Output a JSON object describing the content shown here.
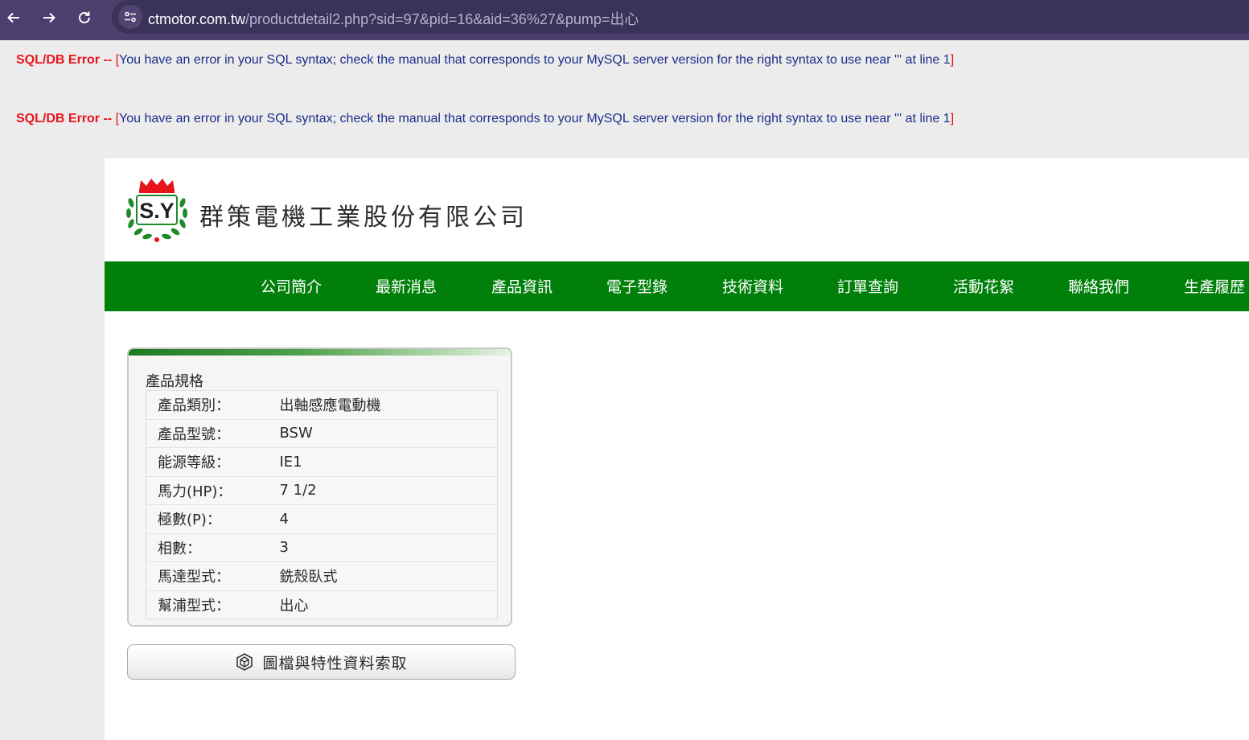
{
  "browser": {
    "url_host": "ctmotor.com.tw",
    "url_path": "/productdetail2.php?sid=97&pid=16&aid=36%27&pump=出心"
  },
  "errors": [
    {
      "label": "SQL/DB Error -- ",
      "bracket_open": "[",
      "message": "You have an error in your SQL syntax; check the manual that corresponds to your MySQL server version for the right syntax to use near ''' at line 1",
      "bracket_close": "]"
    },
    {
      "label": "SQL/DB Error -- ",
      "bracket_open": "[",
      "message": "You have an error in your SQL syntax; check the manual that corresponds to your MySQL server version for the right syntax to use near ''' at line 1",
      "bracket_close": "]"
    }
  ],
  "header": {
    "logo_text": "S.Y",
    "company_name": "群策電機工業股份有限公司"
  },
  "menu": [
    {
      "label": "公司簡介"
    },
    {
      "label": "最新消息"
    },
    {
      "label": "產品資訊"
    },
    {
      "label": "電子型錄"
    },
    {
      "label": "技術資料"
    },
    {
      "label": "訂單查詢"
    },
    {
      "label": "活動花絮"
    },
    {
      "label": "聯絡我們"
    },
    {
      "label": "生產履歷"
    }
  ],
  "spec": {
    "title": "產品規格",
    "rows": [
      {
        "key": "產品類別：",
        "value": "出軸感應電動機"
      },
      {
        "key": "產品型號：",
        "value": "BSW"
      },
      {
        "key": "能源等級：",
        "value": "IE1"
      },
      {
        "key": "馬力(HP)：",
        "value": "7 1/2"
      },
      {
        "key": "極數(P)：",
        "value": "4"
      },
      {
        "key": "相數：",
        "value": "3"
      },
      {
        "key": "馬達型式：",
        "value": "銑殼臥式"
      },
      {
        "key": "幫浦型式：",
        "value": "出心"
      }
    ]
  },
  "download": {
    "label": "圖檔與特性資料索取",
    "icon": "cube-icon"
  },
  "colors": {
    "browser_bar": "#4a3f6d",
    "menu_green": "#00800b",
    "error_red": "#e8141b",
    "error_blue": "#1c2d8a"
  }
}
